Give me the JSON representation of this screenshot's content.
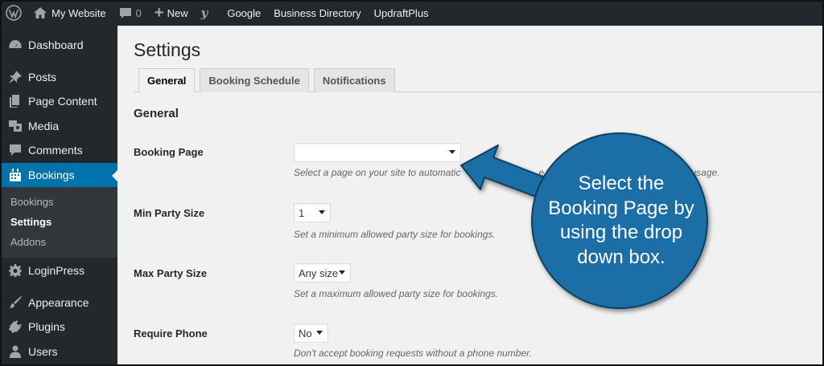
{
  "adminbar": {
    "site_name": "My Website",
    "comment_count": "0",
    "new_label": "New",
    "yoast_label": "y",
    "links": [
      "Google",
      "Business Directory",
      "UpdraftPlus"
    ]
  },
  "sidebar": {
    "items": [
      {
        "label": "Dashboard",
        "icon": "dashboard-icon"
      },
      {
        "label": "Posts",
        "icon": "pin-icon"
      },
      {
        "label": "Page Content",
        "icon": "page-icon"
      },
      {
        "label": "Media",
        "icon": "media-icon"
      },
      {
        "label": "Comments",
        "icon": "comment-icon"
      },
      {
        "label": "Bookings",
        "icon": "calendar-icon"
      }
    ],
    "submenu": [
      "Bookings",
      "Settings",
      "Addons"
    ],
    "items_after": [
      {
        "label": "LoginPress",
        "icon": "gear-icon"
      },
      {
        "label": "Appearance",
        "icon": "brush-icon"
      },
      {
        "label": "Plugins",
        "icon": "plug-icon"
      },
      {
        "label": "Users",
        "icon": "user-icon"
      }
    ]
  },
  "page": {
    "title": "Settings",
    "tabs": [
      "General",
      "Booking Schedule",
      "Notifications"
    ],
    "section_title": "General",
    "fields": [
      {
        "label": "Booking Page",
        "value": "",
        "description": "Select a page on your site to automatic",
        "description_tail": "e book",
        "description_end": "usage."
      },
      {
        "label": "Min Party Size",
        "value": "1",
        "description": "Set a minimum allowed party size for bookings."
      },
      {
        "label": "Max Party Size",
        "value": "Any size",
        "description": "Set a maximum allowed party size for bookings."
      },
      {
        "label": "Require Phone",
        "value": "No",
        "description": "Don't accept booking requests without a phone number."
      }
    ]
  },
  "callout": {
    "text": "Select the Booking Page by using the drop down box.",
    "color": "#1a6ea6"
  },
  "colors": {
    "adminbar_bg": "#23282d",
    "accent": "#0073aa"
  }
}
